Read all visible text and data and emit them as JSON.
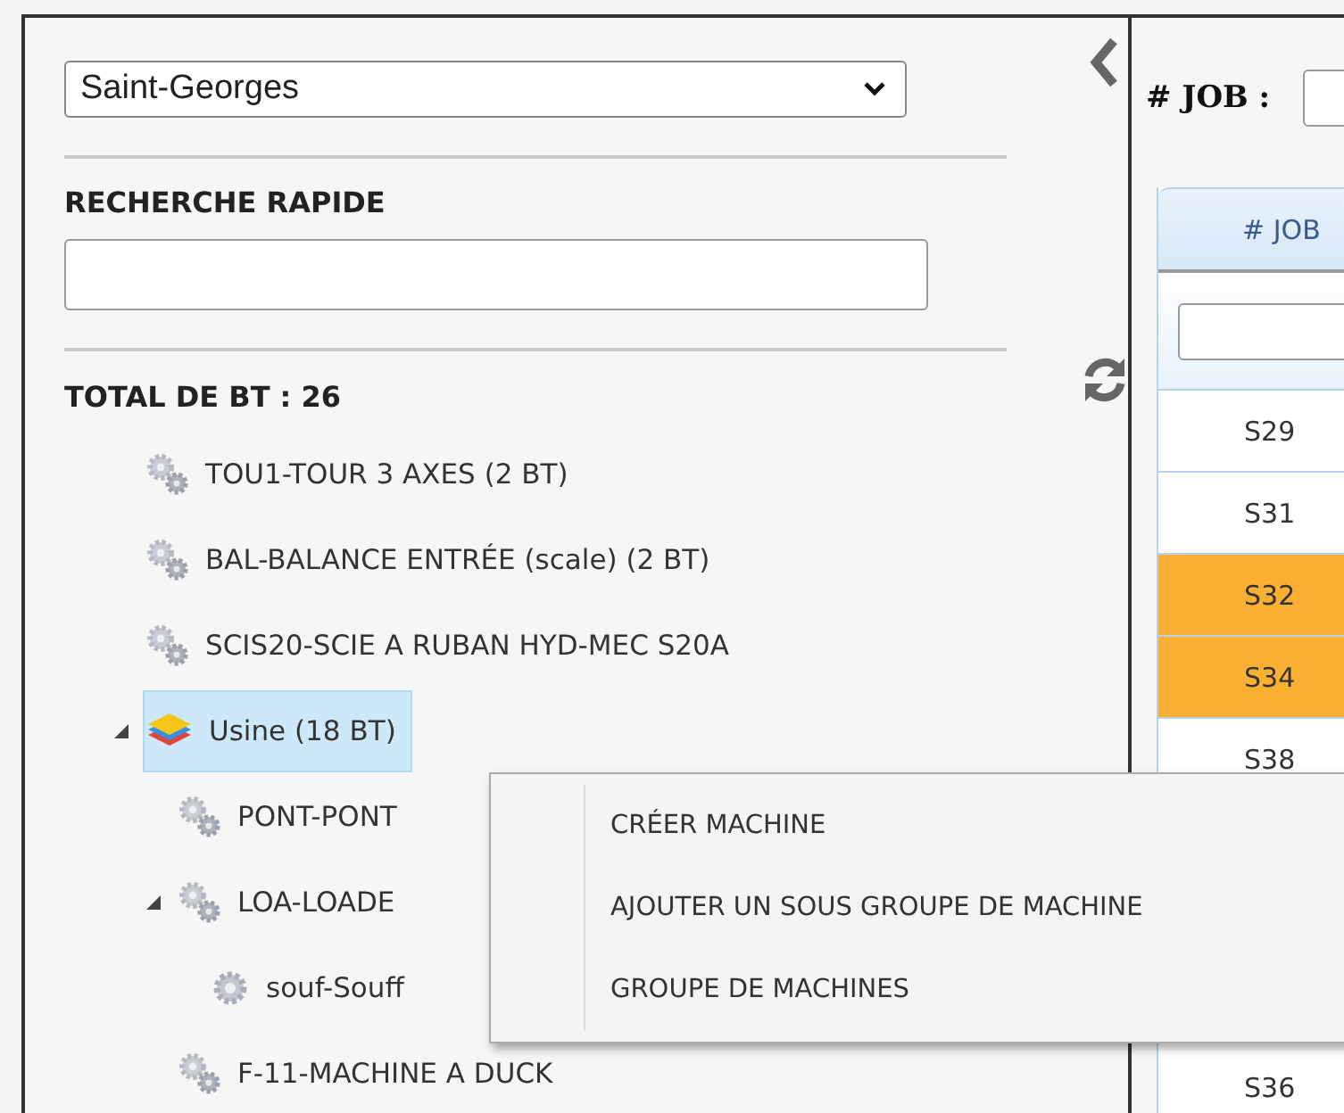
{
  "location_select": {
    "value": "Saint-Georges"
  },
  "quick_search": {
    "label": "RECHERCHE RAPIDE"
  },
  "total": "TOTAL DE BT : 26",
  "tree": [
    {
      "kind": "machine",
      "label": "TOU1-TOUR 3 AXES (2 BT)",
      "selected": false
    },
    {
      "kind": "machine",
      "label": "BAL-BALANCE ENTRÉE (scale) (2 BT)",
      "selected": false
    },
    {
      "kind": "machine",
      "label": "SCIS20-SCIE A RUBAN HYD-MEC S20A",
      "selected": false
    },
    {
      "kind": "group",
      "label": "Usine (18 BT)",
      "selected": true,
      "expanded": true,
      "children": [
        {
          "kind": "machine",
          "label": "PONT-PONT",
          "selected": false
        },
        {
          "kind": "machine",
          "label": "LOA-LOADE",
          "selected": false,
          "expanded": true,
          "children": [
            {
              "kind": "part",
              "label": "souf-Souff",
              "selected": false
            }
          ]
        },
        {
          "kind": "machine",
          "label": "F-11-MACHINE A DUCK",
          "selected": false
        }
      ]
    }
  ],
  "job_filter": {
    "label": "# JOB :"
  },
  "table": {
    "columns": [
      "# JOB"
    ],
    "rows": [
      {
        "cell": "S29",
        "highlighted": false
      },
      {
        "cell": "S31",
        "highlighted": false
      },
      {
        "cell": "S32",
        "highlighted": true
      },
      {
        "cell": "S34",
        "highlighted": true
      },
      {
        "cell": "S38",
        "highlighted": false
      }
    ],
    "rows_below_menu": [
      {
        "cell": "S36",
        "highlighted": false
      }
    ]
  },
  "context_menu": {
    "items": [
      "CRÉER MACHINE",
      "AJOUTER UN SOUS GROUPE DE MACHINE",
      "GROUPE DE MACHINES"
    ]
  }
}
